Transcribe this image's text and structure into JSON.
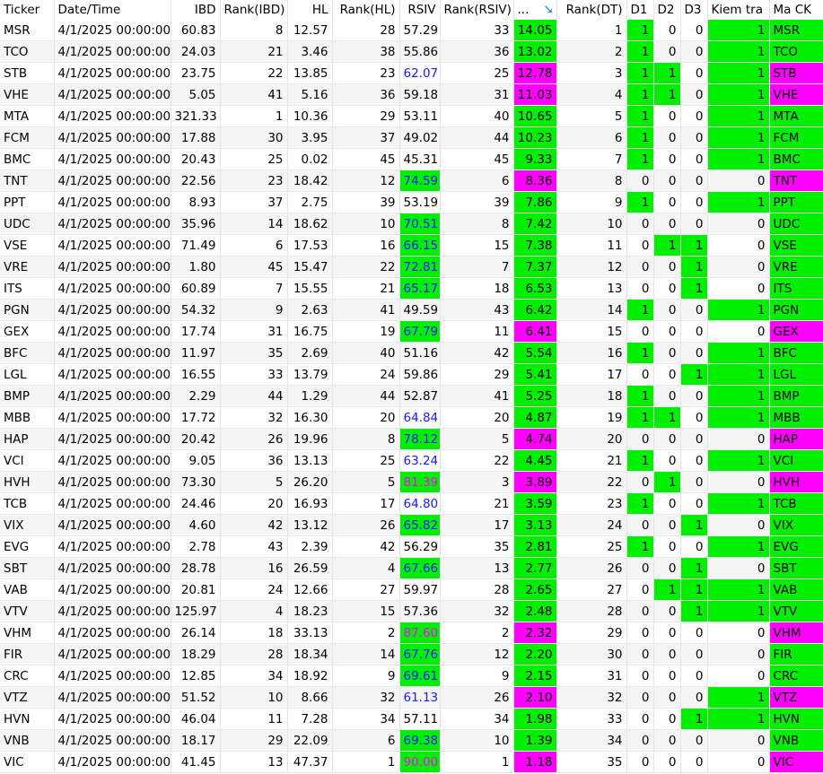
{
  "headers": {
    "ticker": "Ticker",
    "date": "Date/Time",
    "ibd": "IBD",
    "rank_ibd": "Rank(IBD)",
    "hl": "HL",
    "rank_hl": "Rank(HL)",
    "rsiv": "RSIV",
    "rank_rsiv": "Rank(RSIV)",
    "dt": "...",
    "rank_dt": "Rank(DT)",
    "d1": "D1",
    "d2": "D2",
    "d3": "D3",
    "kiem": "Kiem tra",
    "mack": "Ma CK"
  },
  "sort_icon": "sort-descending-icon",
  "colors": {
    "green": "#00ee00",
    "magenta": "#ff00ff",
    "blue": "#1a1aff"
  },
  "rows": [
    {
      "t": "MSR",
      "d": "4/1/2025 00:00:00",
      "ibd": "60.83",
      "ri": "8",
      "hl": "12.57",
      "rh": "28",
      "rs": "57.29",
      "rr": "33",
      "dt": "14.05",
      "rd": "1",
      "d1": "1",
      "d2": "0",
      "d3": "0",
      "k": "1",
      "c": "g"
    },
    {
      "t": "TCO",
      "d": "4/1/2025 00:00:00",
      "ibd": "24.03",
      "ri": "21",
      "hl": "3.46",
      "rh": "38",
      "rs": "55.86",
      "rr": "36",
      "dt": "13.02",
      "rd": "2",
      "d1": "1",
      "d2": "0",
      "d3": "0",
      "k": "1",
      "c": "g"
    },
    {
      "t": "STB",
      "d": "4/1/2025 00:00:00",
      "ibd": "23.75",
      "ri": "22",
      "hl": "13.85",
      "rh": "23",
      "rs": "62.07",
      "rr": "25",
      "dt": "12.78",
      "rd": "3",
      "d1": "1",
      "d2": "1",
      "d3": "0",
      "k": "1",
      "c": "m"
    },
    {
      "t": "VHE",
      "d": "4/1/2025 00:00:00",
      "ibd": "5.05",
      "ri": "41",
      "hl": "5.16",
      "rh": "36",
      "rs": "59.18",
      "rr": "31",
      "dt": "11.03",
      "rd": "4",
      "d1": "1",
      "d2": "1",
      "d3": "0",
      "k": "1",
      "c": "m"
    },
    {
      "t": "MTA",
      "d": "4/1/2025 00:00:00",
      "ibd": "321.33",
      "ri": "1",
      "hl": "10.36",
      "rh": "29",
      "rs": "53.11",
      "rr": "40",
      "dt": "10.65",
      "rd": "5",
      "d1": "1",
      "d2": "0",
      "d3": "0",
      "k": "1",
      "c": "g"
    },
    {
      "t": "FCM",
      "d": "4/1/2025 00:00:00",
      "ibd": "17.88",
      "ri": "30",
      "hl": "3.95",
      "rh": "37",
      "rs": "49.02",
      "rr": "44",
      "dt": "10.23",
      "rd": "6",
      "d1": "1",
      "d2": "0",
      "d3": "0",
      "k": "1",
      "c": "g"
    },
    {
      "t": "BMC",
      "d": "4/1/2025 00:00:00",
      "ibd": "20.43",
      "ri": "25",
      "hl": "0.02",
      "rh": "45",
      "rs": "45.31",
      "rr": "45",
      "dt": "9.33",
      "rd": "7",
      "d1": "1",
      "d2": "0",
      "d3": "0",
      "k": "1",
      "c": "g"
    },
    {
      "t": "TNT",
      "d": "4/1/2025 00:00:00",
      "ibd": "22.56",
      "ri": "23",
      "hl": "18.42",
      "rh": "12",
      "rs": "74.59",
      "rr": "6",
      "dt": "8.36",
      "rd": "8",
      "d1": "0",
      "d2": "0",
      "d3": "0",
      "k": "0",
      "c": "m"
    },
    {
      "t": "PPT",
      "d": "4/1/2025 00:00:00",
      "ibd": "8.93",
      "ri": "37",
      "hl": "2.75",
      "rh": "39",
      "rs": "53.19",
      "rr": "39",
      "dt": "7.86",
      "rd": "9",
      "d1": "1",
      "d2": "0",
      "d3": "0",
      "k": "1",
      "c": "g"
    },
    {
      "t": "UDC",
      "d": "4/1/2025 00:00:00",
      "ibd": "35.96",
      "ri": "14",
      "hl": "18.62",
      "rh": "10",
      "rs": "70.51",
      "rr": "8",
      "dt": "7.42",
      "rd": "10",
      "d1": "0",
      "d2": "0",
      "d3": "0",
      "k": "0",
      "c": "g"
    },
    {
      "t": "VSE",
      "d": "4/1/2025 00:00:00",
      "ibd": "71.49",
      "ri": "6",
      "hl": "17.53",
      "rh": "16",
      "rs": "66.15",
      "rr": "15",
      "dt": "7.38",
      "rd": "11",
      "d1": "0",
      "d2": "1",
      "d3": "1",
      "k": "0",
      "c": "g"
    },
    {
      "t": "VRE",
      "d": "4/1/2025 00:00:00",
      "ibd": "1.80",
      "ri": "45",
      "hl": "15.47",
      "rh": "22",
      "rs": "72.81",
      "rr": "7",
      "dt": "7.37",
      "rd": "12",
      "d1": "0",
      "d2": "0",
      "d3": "1",
      "k": "0",
      "c": "g"
    },
    {
      "t": "ITS",
      "d": "4/1/2025 00:00:00",
      "ibd": "60.89",
      "ri": "7",
      "hl": "15.55",
      "rh": "21",
      "rs": "65.17",
      "rr": "18",
      "dt": "6.53",
      "rd": "13",
      "d1": "0",
      "d2": "0",
      "d3": "1",
      "k": "0",
      "c": "g"
    },
    {
      "t": "PGN",
      "d": "4/1/2025 00:00:00",
      "ibd": "54.32",
      "ri": "9",
      "hl": "2.63",
      "rh": "41",
      "rs": "49.59",
      "rr": "43",
      "dt": "6.42",
      "rd": "14",
      "d1": "1",
      "d2": "0",
      "d3": "0",
      "k": "1",
      "c": "g"
    },
    {
      "t": "GEX",
      "d": "4/1/2025 00:00:00",
      "ibd": "17.74",
      "ri": "31",
      "hl": "16.75",
      "rh": "19",
      "rs": "67.79",
      "rr": "11",
      "dt": "6.41",
      "rd": "15",
      "d1": "0",
      "d2": "0",
      "d3": "0",
      "k": "0",
      "c": "m"
    },
    {
      "t": "BFC",
      "d": "4/1/2025 00:00:00",
      "ibd": "11.97",
      "ri": "35",
      "hl": "2.69",
      "rh": "40",
      "rs": "51.16",
      "rr": "42",
      "dt": "5.54",
      "rd": "16",
      "d1": "1",
      "d2": "0",
      "d3": "0",
      "k": "1",
      "c": "g"
    },
    {
      "t": "LGL",
      "d": "4/1/2025 00:00:00",
      "ibd": "16.55",
      "ri": "33",
      "hl": "13.79",
      "rh": "24",
      "rs": "59.86",
      "rr": "29",
      "dt": "5.41",
      "rd": "17",
      "d1": "0",
      "d2": "0",
      "d3": "1",
      "k": "1",
      "c": "g"
    },
    {
      "t": "BMP",
      "d": "4/1/2025 00:00:00",
      "ibd": "2.29",
      "ri": "44",
      "hl": "1.29",
      "rh": "44",
      "rs": "52.87",
      "rr": "41",
      "dt": "5.25",
      "rd": "18",
      "d1": "1",
      "d2": "0",
      "d3": "0",
      "k": "1",
      "c": "g"
    },
    {
      "t": "MBB",
      "d": "4/1/2025 00:00:00",
      "ibd": "17.72",
      "ri": "32",
      "hl": "16.30",
      "rh": "20",
      "rs": "64.84",
      "rr": "20",
      "dt": "4.87",
      "rd": "19",
      "d1": "1",
      "d2": "1",
      "d3": "0",
      "k": "1",
      "c": "g"
    },
    {
      "t": "HAP",
      "d": "4/1/2025 00:00:00",
      "ibd": "20.42",
      "ri": "26",
      "hl": "19.96",
      "rh": "8",
      "rs": "78.12",
      "rr": "5",
      "dt": "4.74",
      "rd": "20",
      "d1": "0",
      "d2": "0",
      "d3": "0",
      "k": "0",
      "c": "m"
    },
    {
      "t": "VCI",
      "d": "4/1/2025 00:00:00",
      "ibd": "9.05",
      "ri": "36",
      "hl": "13.13",
      "rh": "25",
      "rs": "63.24",
      "rr": "22",
      "dt": "4.45",
      "rd": "21",
      "d1": "1",
      "d2": "0",
      "d3": "0",
      "k": "1",
      "c": "g"
    },
    {
      "t": "HVH",
      "d": "4/1/2025 00:00:00",
      "ibd": "73.30",
      "ri": "5",
      "hl": "26.20",
      "rh": "5",
      "rs": "81.39",
      "rr": "3",
      "dt": "3.89",
      "rd": "22",
      "d1": "0",
      "d2": "1",
      "d3": "0",
      "k": "0",
      "c": "m"
    },
    {
      "t": "TCB",
      "d": "4/1/2025 00:00:00",
      "ibd": "24.46",
      "ri": "20",
      "hl": "16.93",
      "rh": "17",
      "rs": "64.80",
      "rr": "21",
      "dt": "3.59",
      "rd": "23",
      "d1": "1",
      "d2": "0",
      "d3": "0",
      "k": "1",
      "c": "g"
    },
    {
      "t": "VIX",
      "d": "4/1/2025 00:00:00",
      "ibd": "4.60",
      "ri": "42",
      "hl": "13.12",
      "rh": "26",
      "rs": "65.82",
      "rr": "17",
      "dt": "3.13",
      "rd": "24",
      "d1": "0",
      "d2": "0",
      "d3": "1",
      "k": "0",
      "c": "g"
    },
    {
      "t": "EVG",
      "d": "4/1/2025 00:00:00",
      "ibd": "2.78",
      "ri": "43",
      "hl": "2.39",
      "rh": "42",
      "rs": "56.29",
      "rr": "35",
      "dt": "2.81",
      "rd": "25",
      "d1": "1",
      "d2": "0",
      "d3": "0",
      "k": "1",
      "c": "g"
    },
    {
      "t": "SBT",
      "d": "4/1/2025 00:00:00",
      "ibd": "28.78",
      "ri": "16",
      "hl": "26.59",
      "rh": "4",
      "rs": "67.66",
      "rr": "13",
      "dt": "2.77",
      "rd": "26",
      "d1": "0",
      "d2": "0",
      "d3": "1",
      "k": "0",
      "c": "g"
    },
    {
      "t": "VAB",
      "d": "4/1/2025 00:00:00",
      "ibd": "20.81",
      "ri": "24",
      "hl": "12.66",
      "rh": "27",
      "rs": "59.97",
      "rr": "28",
      "dt": "2.65",
      "rd": "27",
      "d1": "0",
      "d2": "1",
      "d3": "1",
      "k": "1",
      "c": "g"
    },
    {
      "t": "VTV",
      "d": "4/1/2025 00:00:00",
      "ibd": "125.97",
      "ri": "4",
      "hl": "18.23",
      "rh": "15",
      "rs": "57.36",
      "rr": "32",
      "dt": "2.48",
      "rd": "28",
      "d1": "0",
      "d2": "0",
      "d3": "1",
      "k": "1",
      "c": "g"
    },
    {
      "t": "VHM",
      "d": "4/1/2025 00:00:00",
      "ibd": "26.14",
      "ri": "18",
      "hl": "33.13",
      "rh": "2",
      "rs": "87.60",
      "rr": "2",
      "dt": "2.32",
      "rd": "29",
      "d1": "0",
      "d2": "0",
      "d3": "0",
      "k": "0",
      "c": "m"
    },
    {
      "t": "FIR",
      "d": "4/1/2025 00:00:00",
      "ibd": "18.29",
      "ri": "28",
      "hl": "18.34",
      "rh": "14",
      "rs": "67.76",
      "rr": "12",
      "dt": "2.20",
      "rd": "30",
      "d1": "0",
      "d2": "0",
      "d3": "0",
      "k": "0",
      "c": "g"
    },
    {
      "t": "CRC",
      "d": "4/1/2025 00:00:00",
      "ibd": "12.85",
      "ri": "34",
      "hl": "18.92",
      "rh": "9",
      "rs": "69.61",
      "rr": "9",
      "dt": "2.15",
      "rd": "31",
      "d1": "0",
      "d2": "0",
      "d3": "0",
      "k": "0",
      "c": "g"
    },
    {
      "t": "VTZ",
      "d": "4/1/2025 00:00:00",
      "ibd": "51.52",
      "ri": "10",
      "hl": "8.66",
      "rh": "32",
      "rs": "61.13",
      "rr": "26",
      "dt": "2.10",
      "rd": "32",
      "d1": "0",
      "d2": "0",
      "d3": "0",
      "k": "1",
      "c": "m"
    },
    {
      "t": "HVN",
      "d": "4/1/2025 00:00:00",
      "ibd": "46.04",
      "ri": "11",
      "hl": "7.28",
      "rh": "34",
      "rs": "57.11",
      "rr": "34",
      "dt": "1.98",
      "rd": "33",
      "d1": "0",
      "d2": "0",
      "d3": "1",
      "k": "1",
      "c": "g"
    },
    {
      "t": "VNB",
      "d": "4/1/2025 00:00:00",
      "ibd": "18.17",
      "ri": "29",
      "hl": "22.09",
      "rh": "6",
      "rs": "69.38",
      "rr": "10",
      "dt": "1.39",
      "rd": "34",
      "d1": "0",
      "d2": "0",
      "d3": "0",
      "k": "0",
      "c": "g"
    },
    {
      "t": "VIC",
      "d": "4/1/2025 00:00:00",
      "ibd": "41.45",
      "ri": "13",
      "hl": "47.37",
      "rh": "1",
      "rs": "90.00",
      "rr": "1",
      "dt": "1.18",
      "rd": "35",
      "d1": "0",
      "d2": "0",
      "d3": "0",
      "k": "0",
      "c": "m"
    }
  ]
}
